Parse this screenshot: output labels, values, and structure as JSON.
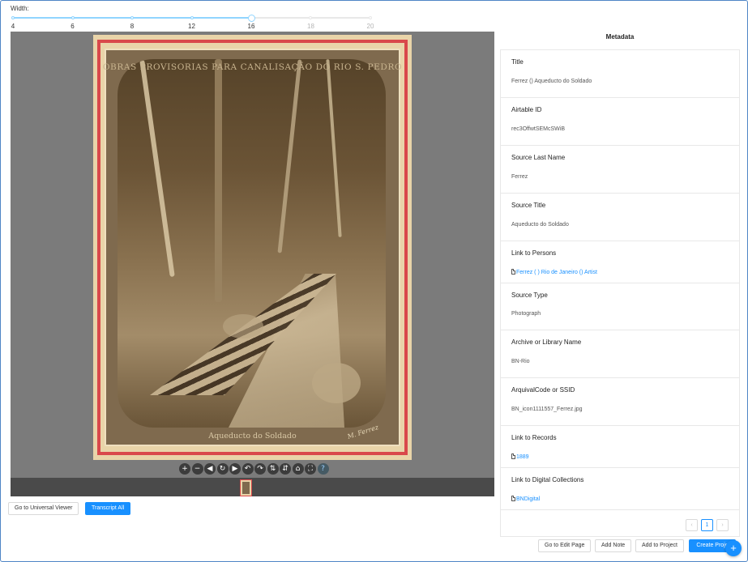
{
  "width_slider": {
    "label": "Width:",
    "value": 16,
    "marks": [
      "4",
      "6",
      "8",
      "12",
      "16",
      "18",
      "20"
    ]
  },
  "viewer": {
    "photo_title": "OBRAS PROVISORIAS PARA CANALISAÇÃO DO RIO S. PEDRO",
    "photo_caption": "Aqueducto do Soldado",
    "signature": "M. Ferrez",
    "toolbar_icons": [
      "zoom-in-icon",
      "zoom-out-icon",
      "previous-icon",
      "rotate-icon",
      "next-icon",
      "rotate-left-icon",
      "rotate-right-icon",
      "flip-icon",
      "flip-vertical-icon",
      "home-icon",
      "fullscreen-icon",
      "help-icon"
    ],
    "toolbar_glyphs": [
      "+",
      "−",
      "◀",
      "↻",
      "▶",
      "↶",
      "↷",
      "⇅",
      "⇵",
      "⌂",
      "⛶",
      "?"
    ]
  },
  "buttons": {
    "universal_viewer": "Go to Universal Viewer",
    "transcript_all": "Transcript All",
    "edit_page": "Go to Edit Page",
    "add_note": "Add Note",
    "add_to_project": "Add to Project",
    "create_project": "Create Proje"
  },
  "metadata": {
    "heading": "Metadata",
    "fields": [
      {
        "label": "Title",
        "value": "Ferrez () Aqueducto do Soldado",
        "link": false
      },
      {
        "label": "Airtable ID",
        "value": "rec3OffwtSEMcSWiB",
        "link": false
      },
      {
        "label": "Source Last Name",
        "value": "Ferrez",
        "link": false
      },
      {
        "label": "Source Title",
        "value": "Aqueducto do Soldado",
        "link": false
      },
      {
        "label": "Link to Persons",
        "value": "Ferrez ( ) Rio de Janeiro () Artist",
        "link": true
      },
      {
        "label": "Source Type",
        "value": "Photograph",
        "link": false
      },
      {
        "label": "Archive or Library Name",
        "value": "BN-Rio",
        "link": false
      },
      {
        "label": "ArquivalCode or SSID",
        "value": "BN_icon1111557_Ferrez.jpg",
        "link": false
      },
      {
        "label": "Link to Records",
        "value": "1889",
        "link": true
      },
      {
        "label": "Link to Digital Collections",
        "value": "BNDigital",
        "link": true
      }
    ],
    "pagination": {
      "prev": "‹",
      "current": "1",
      "next": "›"
    }
  },
  "fab_label": "+",
  "colors": {
    "accent": "#1890ff",
    "mount": "#e9d4a9",
    "stripe": "#d9484b",
    "viewer_bg": "#7b7b7b"
  }
}
